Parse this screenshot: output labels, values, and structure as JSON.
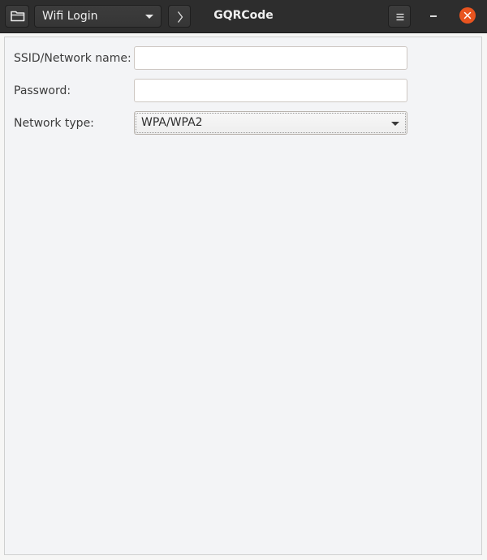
{
  "window": {
    "title": "GQRCode"
  },
  "headerbar": {
    "open_icon": "folder-open-icon",
    "type_selector": {
      "selected": "Wifi Login",
      "icon": "chevron-down-icon"
    },
    "next_icon": "chevron-right-icon",
    "menu_icon": "hamburger-menu-icon",
    "minimize_icon": "minimize-icon",
    "close_icon": "close-icon"
  },
  "form": {
    "ssid": {
      "label": "SSID/Network name:",
      "value": ""
    },
    "password": {
      "label": "Password:",
      "value": ""
    },
    "network_type": {
      "label": "Network type:",
      "selected": "WPA/WPA2"
    }
  },
  "colors": {
    "headerbar_bg": "#2d2d2d",
    "close_button": "#e9541f",
    "content_bg": "#f3f4f6"
  }
}
